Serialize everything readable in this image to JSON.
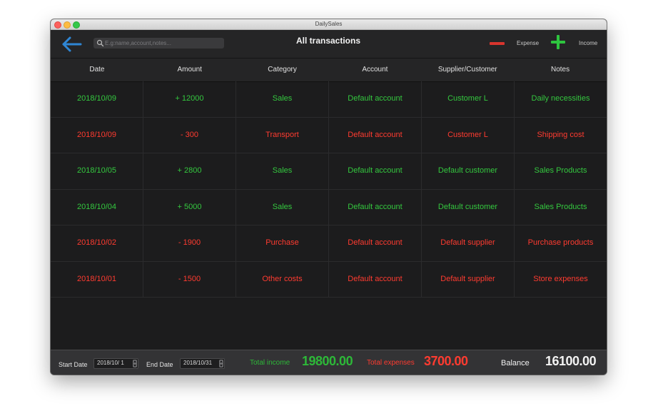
{
  "window": {
    "title": "DailySales"
  },
  "toolbar": {
    "search_placeholder": "E.g:name,account,notes...",
    "page_title": "All transactions",
    "expense_label": "Expense",
    "income_label": "Income"
  },
  "colors": {
    "income": "#34c83f",
    "expense": "#ff3b30",
    "accent": "#2f86d4"
  },
  "table": {
    "columns": [
      "Date",
      "Amount",
      "Category",
      "Account",
      "Supplier/Customer",
      "Notes"
    ],
    "rows": [
      {
        "type": "income",
        "cells": [
          "2018/10/09",
          "+ 12000",
          "Sales",
          "Default account",
          "Customer L",
          "Daily necessities"
        ]
      },
      {
        "type": "expense",
        "cells": [
          "2018/10/09",
          "- 300",
          "Transport",
          "Default account",
          "Customer L",
          "Shipping cost"
        ]
      },
      {
        "type": "income",
        "cells": [
          "2018/10/05",
          "+ 2800",
          "Sales",
          "Default account",
          "Default customer",
          "Sales Products"
        ]
      },
      {
        "type": "income",
        "cells": [
          "2018/10/04",
          "+ 5000",
          "Sales",
          "Default account",
          "Default customer",
          "Sales Products"
        ]
      },
      {
        "type": "expense",
        "cells": [
          "2018/10/02",
          "- 1900",
          "Purchase",
          "Default account",
          "Default supplier",
          "Purchase products"
        ]
      },
      {
        "type": "expense",
        "cells": [
          "2018/10/01",
          "- 1500",
          "Other costs",
          "Default account",
          "Default supplier",
          "Store expenses"
        ]
      }
    ]
  },
  "footer": {
    "start_label": "Start Date",
    "start_value": "2018/10/ 1",
    "end_label": "End Date",
    "end_value": "2018/10/31",
    "income_label": "Total income",
    "income_value": "19800.00",
    "expense_label": "Total expenses",
    "expense_value": "3700.00",
    "balance_label": "Balance",
    "balance_value": "16100.00"
  }
}
